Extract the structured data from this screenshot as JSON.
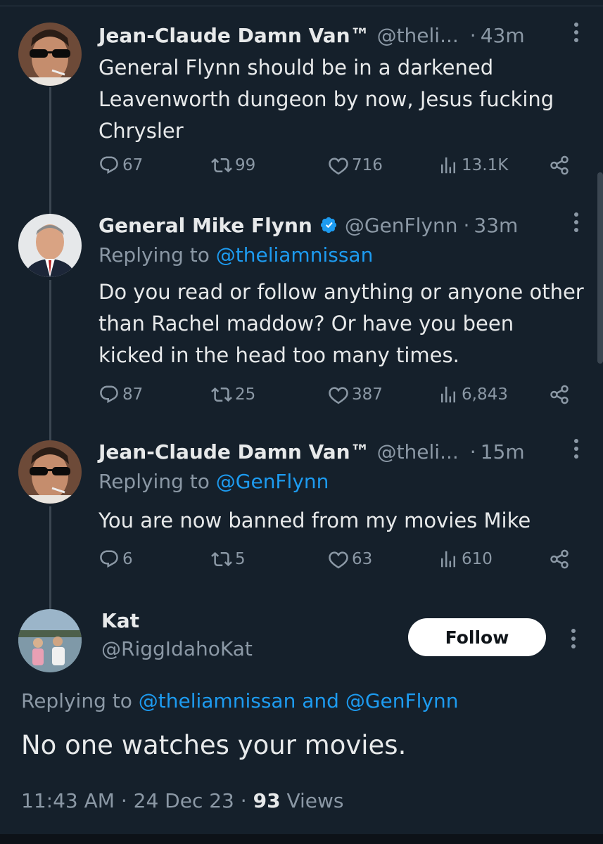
{
  "tweets": [
    {
      "name": "Jean-Claude Damn Van™",
      "handle": "@theli...",
      "time": "43m",
      "body": "General Flynn should be in a darkened Leavenworth dungeon by now, Jesus fucking Chrysler",
      "replies": "67",
      "retweets": "99",
      "likes": "716",
      "views": "13.1K"
    },
    {
      "name": "General Mike Flynn",
      "handle": "@GenFlynn",
      "time": "33m",
      "replying_label": "Replying to",
      "replying_to": "@theliamnissan",
      "body": "Do you read or follow anything or anyone other than Rachel maddow? Or have you been kicked in the head too many times.",
      "replies": "87",
      "retweets": "25",
      "likes": "387",
      "views": "6,843",
      "verified": true
    },
    {
      "name": "Jean-Claude Damn Van™",
      "handle": "@theli...",
      "time": "15m",
      "replying_label": "Replying to",
      "replying_to": "@GenFlynn",
      "body": "You are now banned from my movies Mike",
      "replies": "6",
      "retweets": "5",
      "likes": "63",
      "views": "610"
    }
  ],
  "main": {
    "name": "Kat",
    "handle": "@RiggIdahoKat",
    "follow_label": "Follow",
    "replying_label": "Replying to",
    "replying_to_1": "@theliamnissan",
    "replying_and": "and",
    "replying_to_2": "@GenFlynn",
    "text": "No one watches your movies.",
    "time": "11:43 AM",
    "date": "24 Dec 23",
    "views_count": "93",
    "views_label": "Views"
  },
  "colors": {
    "background": "#15202b",
    "text": "#e7e9ea",
    "secondary": "#8b98a5",
    "link": "#1d9bf0",
    "verified": "#1d9bf0"
  },
  "icons": [
    "more-icon",
    "verified-icon",
    "reply-icon",
    "retweet-icon",
    "like-icon",
    "views-icon",
    "share-icon"
  ]
}
